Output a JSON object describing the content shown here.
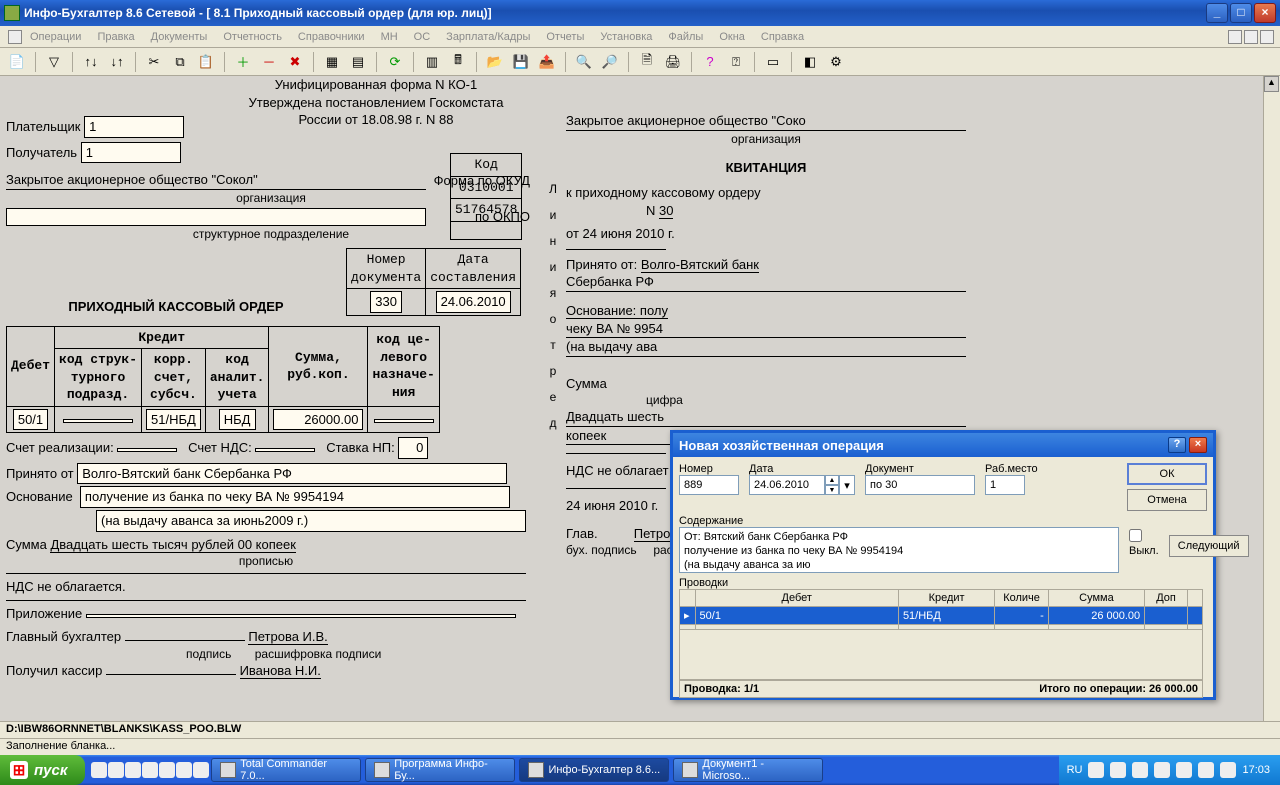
{
  "window": {
    "title": "Инфо-Бухгалтер 8.6 Сетевой - [  8.1 Приходный кассовый ордер (для юр. лиц)]"
  },
  "menu": [
    "Операции",
    "Правка",
    "Документы",
    "Отчетность",
    "Справочники",
    "МН",
    "ОС",
    "Зарплата/Кадры",
    "Отчеты",
    "Установка",
    "Файлы",
    "Окна",
    "Справка"
  ],
  "doc": {
    "form_line1": "Унифицированная форма N КО-1",
    "form_line2": "Утверждена постановлением Госкомстата",
    "form_line3": "России от 18.08.98 г. N 88",
    "payer_label": "Плательщик",
    "payer": "1",
    "receiver_label": "Получатель",
    "receiver": "1",
    "kod_label": "Код",
    "org_name": "Закрытое акционерное общество \"Сокол\"",
    "okud_label": "Форма по ОКУД",
    "okud": "0310001",
    "org_caption": "организация",
    "okpo_label": "по ОКПО",
    "okpo": "51764578",
    "subdiv_caption": "структурное подразделение",
    "doc_title": "ПРИХОДНЫЙ КАССОВЫЙ ОРДЕР",
    "num_label": "Номер\nдокумента",
    "num": "330",
    "date_label": "Дата\nсоставления",
    "date": "24.06.2010",
    "thead": {
      "debet": "Дебет",
      "credit": "Кредит",
      "struct": "код струк-\nтурного\nподразд.",
      "korr": "корр.\nсчет,\nсубсч.",
      "anal": "код\nаналит.\nучета",
      "sum": "Сумма,\nруб.коп.",
      "target": "код це-\nлевого\nназначе-\nния"
    },
    "row": {
      "debet": "50/1",
      "struct": "",
      "korr": "51/НБД",
      "anal": "НБД",
      "sum": "26000.00",
      "target": ""
    },
    "realiz_label": "Счет реализации:",
    "realiz": "",
    "nds_acct_label": "Счет НДС:",
    "nds_acct": "",
    "rate_label": "Ставка НП:",
    "rate": "0",
    "from_label": "Принято от",
    "from": "Волго-Вятский банк Сбербанка РФ",
    "basis_label": "Основание",
    "basis": "получение из банка по чеку ВА № 9954194",
    "basis2": "(на выдачу аванса за июнь2009 г.)",
    "sum_words_label": "Сумма",
    "sum_words": "Двадцать шесть тысяч рублей 00 копеек",
    "sum_caption": "прописью",
    "nds_text": "НДС не облагается.",
    "attach_label": "Приложение",
    "attach": "",
    "chief_label": "Главный бухгалтер",
    "chief": "Петрова И.В.",
    "sign_caption": "подпись",
    "sign_decode": "расшифровка подписи",
    "cashier_label": "Получил кассир",
    "cashier": "Иванова Н.И."
  },
  "receipt": {
    "org": "Закрытое акционерное общество \"Соко",
    "org_caption": "организация",
    "title": "КВИТАНЦИЯ",
    "to_order": "к приходному кассовому ордеру",
    "num_label": "N",
    "num": "30",
    "date_line": "от 24 июня 2010 г.",
    "from_label": "Принято от:",
    "from1": "Волго-Вятский банк",
    "from2": "Сбербанка РФ",
    "basis_label": "Основание: полу",
    "basis1": "чеку ВА № 9954",
    "basis2": "(на выдачу ава",
    "sum_label": "Сумма",
    "sum_caption": "цифра",
    "words1": "Двадцать шесть",
    "words2": "копеек",
    "nds": "НДС не облагает",
    "date2": "24 июня 2010 г.",
    "chief_label": "Глав.",
    "chief": "Петрова И.В.",
    "sub_label": "бух. подпись",
    "sub_decode": "расшифровка подписи"
  },
  "dlg": {
    "title": "Новая хозяйственная операция",
    "num_label": "Номер",
    "num": "889",
    "date_label": "Дата",
    "date": "24.06.2010",
    "doc_label": "Документ",
    "doc": "по 30",
    "wp_label": "Раб.место",
    "wp": "1",
    "ok": "ОК",
    "cancel": "Отмена",
    "next": "Следующий",
    "content_label": "Содержание",
    "content": "От: Вятский банк Сбербанка РФ\nполучение из банка по чеку ВА № 9954194\n(на выдачу аванса за ию",
    "off_label": "Выкл.",
    "postings_label": "Проводки",
    "cols": {
      "debet": "Дебет",
      "kredit": "Кредит",
      "qty": "Количе",
      "sum": "Сумма",
      "dop": "Доп"
    },
    "row": {
      "debet": "50/1",
      "kredit": "51/НБД",
      "qty": "-",
      "sum": "26 000.00",
      "dop": ""
    },
    "status_left": "Проводка: 1/1",
    "status_right": "Итого по операции: 26 000.00"
  },
  "pathline": "D:\\IBW86ORNNET\\BLANKS\\KASS_POO.BLW",
  "statusbar": "Заполнение бланка...",
  "taskbar": {
    "start": "пуск",
    "tasks": [
      "Total Commander 7.0...",
      "Программа Инфо-Бу...",
      "Инфо-Бухгалтер 8.6...",
      "Документ1 - Microso..."
    ],
    "lang": "RU",
    "clock": "17:03"
  },
  "side_letters": [
    "Л",
    "и",
    "н",
    "и",
    "я",
    "",
    "о",
    "",
    "т",
    "",
    "р",
    "",
    "е",
    "",
    "д"
  ]
}
